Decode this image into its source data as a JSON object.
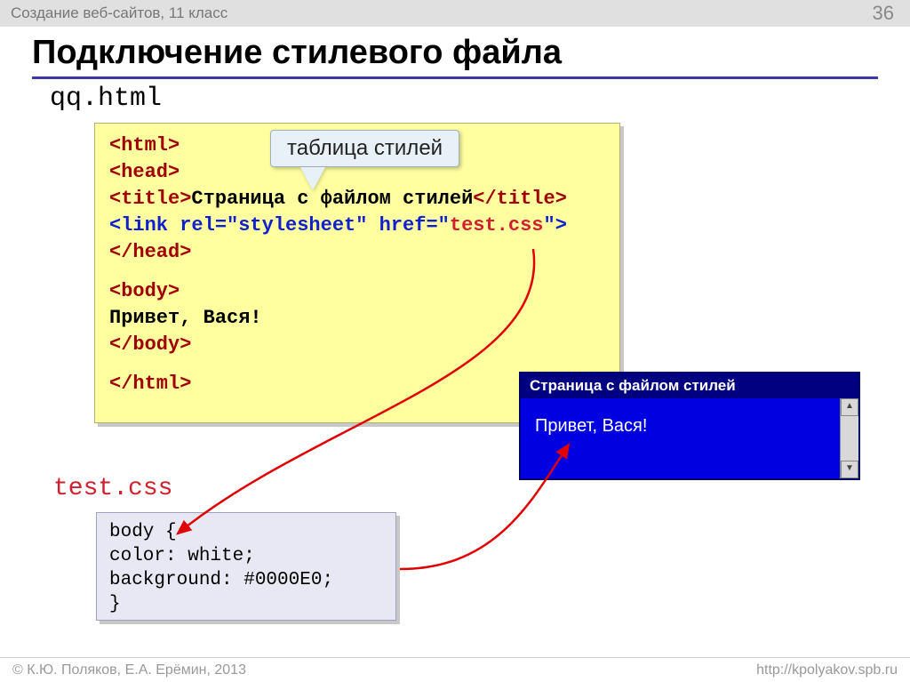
{
  "topbar": {
    "course": "Создание веб-сайтов, 11 класс",
    "page": "36"
  },
  "title": "Подключение стилевого файла",
  "filenames": {
    "html": "qq.html",
    "css": "test.css"
  },
  "callout": "таблица стилей",
  "html_code": {
    "l1": "<html>",
    "l2": "<head>",
    "l3a": "<title>",
    "l3b": "Страница с файлом стилей",
    "l3c": "</title>",
    "l4a": "<link rel=\"stylesheet\" href=\"",
    "l4b": "test.css",
    "l4c": "\">",
    "l5": "</head>",
    "l6": "<body>",
    "l7": "Привет, Вася!",
    "l8": "</body>",
    "l9": "</html>"
  },
  "css_code": {
    "l1": "body {",
    "l2": "  color: white;",
    "l3": "  background: #0000E0;",
    "l4": "}"
  },
  "preview": {
    "title": "Страница с файлом стилей",
    "body": "Привет, Вася!"
  },
  "footer": {
    "left": "© К.Ю. Поляков, Е.А. Ерёмин, 2013",
    "right": "http://kpolyakov.spb.ru"
  },
  "scroll": {
    "up": "▲",
    "down": "▼"
  }
}
